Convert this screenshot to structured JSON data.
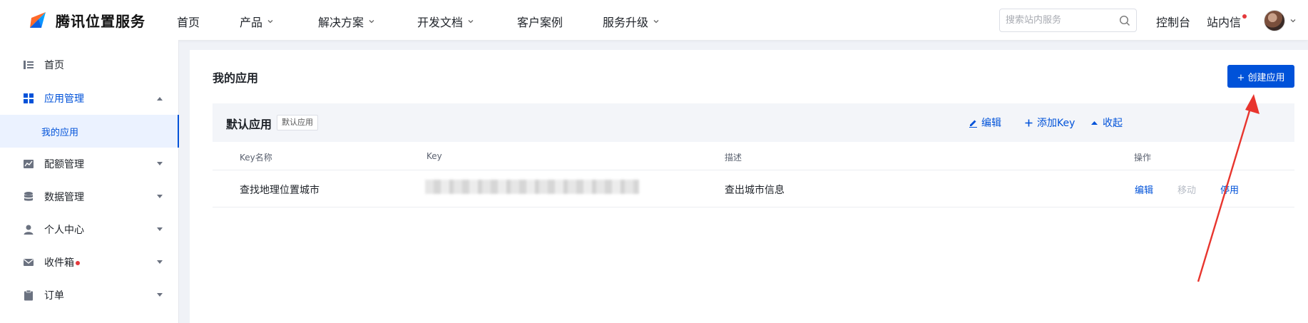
{
  "brand": {
    "name": "腾讯位置服务"
  },
  "nav": {
    "items": [
      {
        "label": "首页",
        "dropdown": false
      },
      {
        "label": "产品",
        "dropdown": true
      },
      {
        "label": "解决方案",
        "dropdown": true
      },
      {
        "label": "开发文档",
        "dropdown": true
      },
      {
        "label": "客户案例",
        "dropdown": false
      },
      {
        "label": "服务升级",
        "dropdown": true
      }
    ],
    "search_placeholder": "搜索站内服务",
    "console": "控制台",
    "messages": "站内信"
  },
  "sidebar": {
    "items": [
      {
        "label": "首页",
        "icon": "list-icon"
      },
      {
        "label": "应用管理",
        "icon": "grid-icon",
        "expanded": true
      },
      {
        "label": "配额管理",
        "icon": "chart-icon"
      },
      {
        "label": "数据管理",
        "icon": "database-icon"
      },
      {
        "label": "个人中心",
        "icon": "user-icon"
      },
      {
        "label": "收件箱",
        "icon": "mail-icon",
        "dot": true
      },
      {
        "label": "订单",
        "icon": "clipboard-icon"
      }
    ],
    "sub_item": "我的应用"
  },
  "main": {
    "title": "我的应用",
    "create_button": "+ 创建应用",
    "app": {
      "name": "默认应用",
      "tag": "默认应用",
      "actions": {
        "edit": "编辑",
        "add_key": "添加Key",
        "collapse": "收起"
      }
    },
    "table": {
      "headers": [
        "Key名称",
        "Key",
        "描述",
        "操作"
      ],
      "rows": [
        {
          "name": "查找地理位置城市",
          "key": "",
          "desc": "查出城市信息",
          "ops": [
            "编辑",
            "移动",
            "停用"
          ]
        }
      ]
    }
  },
  "colors": {
    "accent": "#0052d9",
    "annotation": "#e8352e",
    "badge": "#e4393c"
  }
}
